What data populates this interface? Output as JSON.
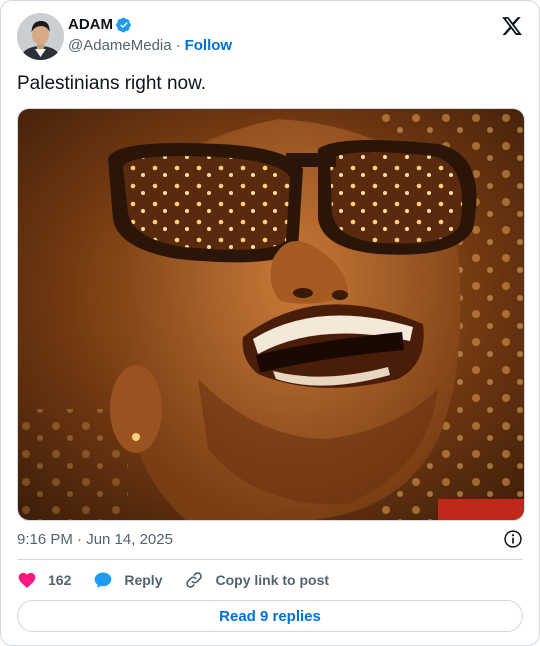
{
  "author": {
    "display_name": "ADAM",
    "handle": "@AdameMedia",
    "separator": "·",
    "follow_label": "Follow",
    "verified": true
  },
  "tweet": {
    "text": "Palestinians right now."
  },
  "meta": {
    "timestamp": "9:16 PM · Jun 14, 2025"
  },
  "actions": {
    "like_count": "162",
    "reply_label": "Reply",
    "copy_label": "Copy link to post"
  },
  "footer": {
    "read_replies_label": "Read 9 replies"
  },
  "colors": {
    "accent": "#006fd6",
    "verified_blue": "#1d9bf0",
    "like_pink": "#f91880",
    "muted_text": "#536471",
    "border": "#cfd9de"
  },
  "icons": {
    "verified": "verified-badge-icon",
    "logo": "x-logo-icon",
    "info": "info-icon",
    "like": "heart-icon",
    "reply": "speech-bubble-icon",
    "copy": "link-icon"
  }
}
